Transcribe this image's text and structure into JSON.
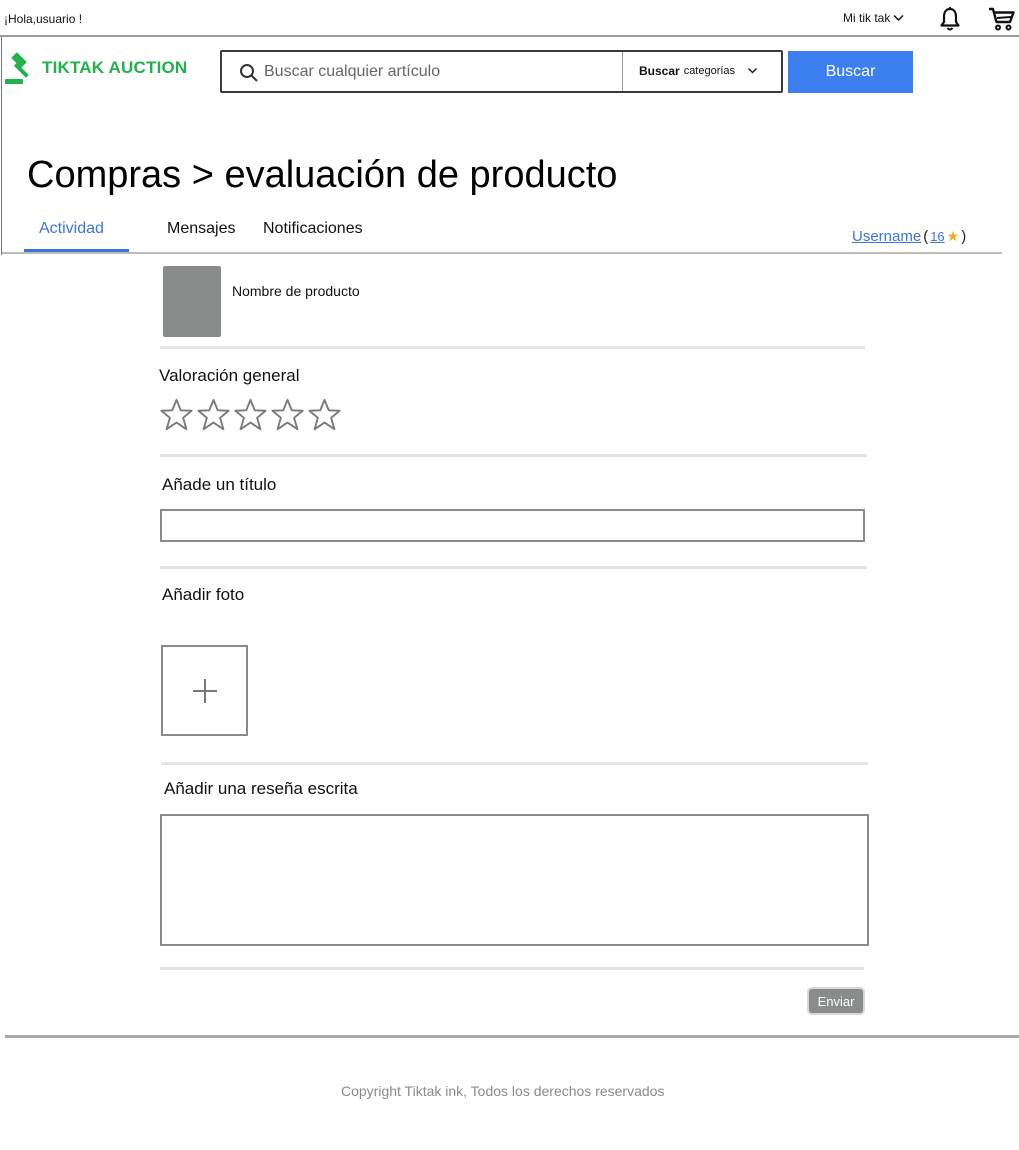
{
  "topbar": {
    "greeting": "¡Hola,usuario !",
    "my_account": "Mi tik tak",
    "icons": [
      "bell-icon",
      "cart-icon",
      "chevron-down-icon"
    ]
  },
  "brand": {
    "logo_text": "TIKTAK AUCTION",
    "color": "#22b14c",
    "icon": "gavel-icon"
  },
  "search": {
    "placeholder": "Buscar cualquier artículo",
    "category_bold": "Buscar",
    "category_rest": "categorías",
    "button_label": "Buscar",
    "button_color": "#3d7ff0"
  },
  "page": {
    "title": "Compras > evaluación de producto"
  },
  "tabs": [
    {
      "label": "Actividad",
      "active": true
    },
    {
      "label": "Mensajes",
      "active": false
    },
    {
      "label": "Notificaciones",
      "active": false
    }
  ],
  "user": {
    "username": "Username",
    "open_paren": "(",
    "score": "16",
    "close_paren": ")",
    "star_color": "#f5a623"
  },
  "product": {
    "name": "Nombre de producto"
  },
  "form": {
    "overall_rating_label": "Valoración general",
    "rating": 0,
    "rating_max": 5,
    "title_label": "Añade un título",
    "title_value": "",
    "photo_label": "Añadir foto",
    "review_label": "Añadir una reseña escrita",
    "review_value": "",
    "submit_label": "Enviar"
  },
  "footer": {
    "copyright": "Copyright Tiktak ink, Todos los derechos reservados"
  },
  "colors": {
    "accent": "#3b73e0",
    "muted_gray": "#8a8c8c"
  }
}
